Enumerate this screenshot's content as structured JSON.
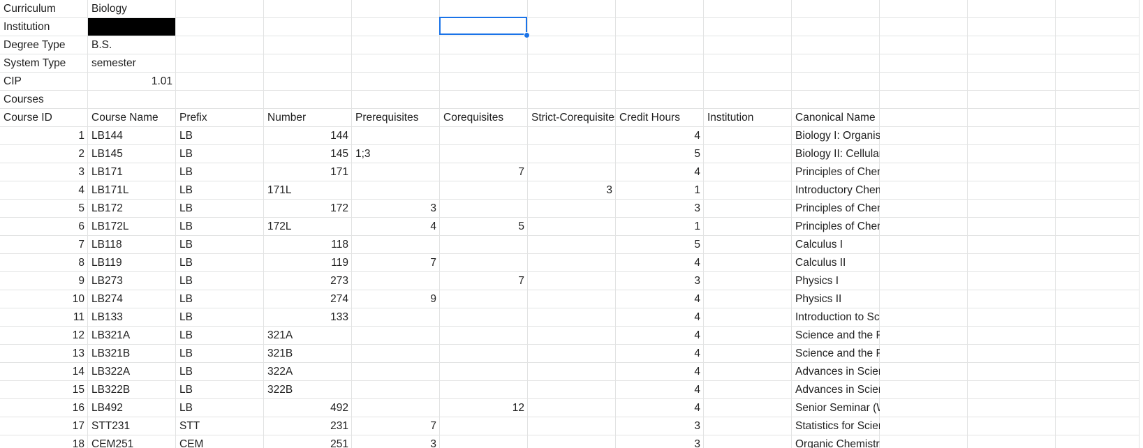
{
  "colors": {
    "gridline": "#e2e3e3",
    "selection": "#1a73e8",
    "redacted": "#000000"
  },
  "metadata": {
    "curriculum": {
      "label": "Curriculum",
      "value": "Biology"
    },
    "institution": {
      "label": "Institution",
      "value": ""
    },
    "degree_type": {
      "label": "Degree Type",
      "value": "B.S."
    },
    "system_type": {
      "label": "System Type",
      "value": "semester"
    },
    "cip": {
      "label": "CIP",
      "value": "1.01"
    },
    "courses_label": "Courses"
  },
  "headers": [
    "Course ID",
    "Course Name",
    "Prefix",
    "Number",
    "Prerequisites",
    "Corequisites",
    "Strict-Corequisites",
    "Credit Hours",
    "Institution",
    "Canonical Name"
  ],
  "courses": [
    {
      "id": "1",
      "name": "LB144",
      "prefix": "LB",
      "number": "144",
      "prereq": "",
      "coreq": "",
      "strict": "",
      "credits": "4",
      "institution": "",
      "canonical": "Biology I: Organismal Biology"
    },
    {
      "id": "2",
      "name": "LB145",
      "prefix": "LB",
      "number": "145",
      "prereq": "1;3",
      "coreq": "",
      "strict": "",
      "credits": "5",
      "institution": "",
      "canonical": "Biology II: Cellular and Molecular Biology"
    },
    {
      "id": "3",
      "name": "LB171",
      "prefix": "LB",
      "number": "171",
      "prereq": "",
      "coreq": "7",
      "strict": "",
      "credits": "4",
      "institution": "",
      "canonical": "Principles of Chemistry I"
    },
    {
      "id": "4",
      "name": "LB171L",
      "prefix": "LB",
      "number": "171L",
      "prereq": "",
      "coreq": "",
      "strict": "3",
      "credits": "1",
      "institution": "",
      "canonical": "Introductory Chemistry Laboratory I"
    },
    {
      "id": "5",
      "name": "LB172",
      "prefix": "LB",
      "number": "172",
      "prereq": "3",
      "coreq": "",
      "strict": "",
      "credits": "3",
      "institution": "",
      "canonical": "Principles of Chemistry II"
    },
    {
      "id": "6",
      "name": "LB172L",
      "prefix": "LB",
      "number": "172L",
      "prereq": "4",
      "coreq": "5",
      "strict": "",
      "credits": "1",
      "institution": "",
      "canonical": "Principles of Chemistry II - Reactivity Laboratory"
    },
    {
      "id": "7",
      "name": "LB118",
      "prefix": "LB",
      "number": "118",
      "prereq": "",
      "coreq": "",
      "strict": "",
      "credits": "5",
      "institution": "",
      "canonical": "Calculus I"
    },
    {
      "id": "8",
      "name": "LB119",
      "prefix": "LB",
      "number": "119",
      "prereq": "7",
      "coreq": "",
      "strict": "",
      "credits": "4",
      "institution": "",
      "canonical": "Calculus II"
    },
    {
      "id": "9",
      "name": "LB273",
      "prefix": "LB",
      "number": "273",
      "prereq": "",
      "coreq": "7",
      "strict": "",
      "credits": "3",
      "institution": "",
      "canonical": "Physics I"
    },
    {
      "id": "10",
      "name": "LB274",
      "prefix": "LB",
      "number": "274",
      "prereq": "9",
      "coreq": "",
      "strict": "",
      "credits": "4",
      "institution": "",
      "canonical": "Physics II"
    },
    {
      "id": "11",
      "name": "LB133",
      "prefix": "LB",
      "number": "133",
      "prereq": "",
      "coreq": "",
      "strict": "",
      "credits": "4",
      "institution": "",
      "canonical": "Introduction to Science and Society"
    },
    {
      "id": "12",
      "name": "LB321A",
      "prefix": "LB",
      "number": "321A",
      "prereq": "",
      "coreq": "",
      "strict": "",
      "credits": "4",
      "institution": "",
      "canonical": "Science and the Public - Arts and Humanities (W)"
    },
    {
      "id": "13",
      "name": "LB321B",
      "prefix": "LB",
      "number": "321B",
      "prereq": "",
      "coreq": "",
      "strict": "",
      "credits": "4",
      "institution": "",
      "canonical": "Science and the Public - Social Sciences (W)"
    },
    {
      "id": "14",
      "name": "LB322A",
      "prefix": "LB",
      "number": "322A",
      "prereq": "",
      "coreq": "",
      "strict": "",
      "credits": "4",
      "institution": "",
      "canonical": "Advances in Science and Technology - Arts and Humanities (W)"
    },
    {
      "id": "15",
      "name": "LB322B",
      "prefix": "LB",
      "number": "322B",
      "prereq": "",
      "coreq": "",
      "strict": "",
      "credits": "4",
      "institution": "",
      "canonical": "Advances in Science and Technology - Social Sciences (W)"
    },
    {
      "id": "16",
      "name": "LB492",
      "prefix": "LB",
      "number": "492",
      "prereq": "",
      "coreq": "12",
      "strict": "",
      "credits": "4",
      "institution": "",
      "canonical": "Senior Seminar (W)"
    },
    {
      "id": "17",
      "name": "STT231",
      "prefix": "STT",
      "number": "231",
      "prereq": "7",
      "coreq": "",
      "strict": "",
      "credits": "3",
      "institution": "",
      "canonical": "Statistics for Scientists"
    },
    {
      "id": "18",
      "name": "CEM251",
      "prefix": "CEM",
      "number": "251",
      "prereq": "3",
      "coreq": "",
      "strict": "",
      "credits": "3",
      "institution": "",
      "canonical": "Organic Chemistry I"
    }
  ]
}
